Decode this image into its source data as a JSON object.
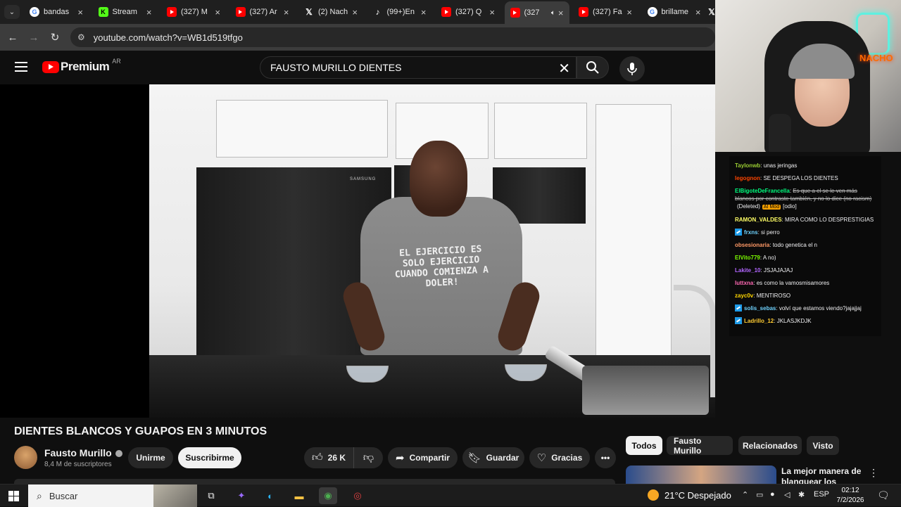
{
  "browser": {
    "tabs": [
      {
        "title": "bandas",
        "favicon": "google-icon",
        "active": false,
        "muted": false
      },
      {
        "title": "Stream",
        "favicon": "kick-icon",
        "active": false,
        "muted": false
      },
      {
        "title": "(327) M",
        "favicon": "youtube-icon",
        "active": false,
        "muted": false
      },
      {
        "title": "(327) Ar",
        "favicon": "youtube-icon",
        "active": false,
        "muted": false
      },
      {
        "title": "(2) Nach",
        "favicon": "x-icon",
        "active": false,
        "muted": false
      },
      {
        "title": "(99+)En",
        "favicon": "tiktok-icon",
        "active": false,
        "muted": false
      },
      {
        "title": "(327) Q",
        "favicon": "youtube-icon",
        "active": false,
        "muted": false
      },
      {
        "title": "(327",
        "favicon": "youtube-icon",
        "active": true,
        "muted": true
      },
      {
        "title": "(327) Fa",
        "favicon": "youtube-icon",
        "active": false,
        "muted": false
      },
      {
        "title": "brillame",
        "favicon": "google-icon",
        "active": false,
        "muted": false
      }
    ],
    "url": "youtube.com/watch?v=WB1d519tfgo"
  },
  "yt": {
    "logo_text": "Premium",
    "region": "AR",
    "search_value": "FAUSTO MURILLO DIENTES"
  },
  "video": {
    "shirt_text": "EL EJERCICIO ES SOLO EJERCICIO CUANDO COMIENZA A DOLER!",
    "fridge_brand": "SAMSUNG",
    "title": "DIENTES BLANCOS Y GUAPOS EN 3 MINUTOS",
    "channel": "Fausto Murillo",
    "subscribers": "8,4 M de suscriptores",
    "join_label": "Unirme",
    "subscribe_label": "Suscribirme",
    "likes": "26 K",
    "share_label": "Compartir",
    "save_label": "Guardar",
    "thanks_label": "Gracias"
  },
  "stream": {
    "neon_text": "NACHO"
  },
  "chat": [
    {
      "user": "Taylonwb",
      "color": "#9acd32",
      "badge": false,
      "deleted": false,
      "message": "unas jeringas"
    },
    {
      "user": "legognon",
      "color": "#ff4500",
      "badge": false,
      "deleted": false,
      "message": "SE DESPEGA LOS DIENTES"
    },
    {
      "user": "ElBigoteDeFrancella",
      "color": "#00ff7f",
      "badge": false,
      "deleted": true,
      "message": "Es que a el se le ven más blancos por contraste también, y no lo dice (no racism)",
      "extra": "(Deleted)",
      "mod": "AI Mod",
      "tag": "[odio]"
    },
    {
      "user": "RAMON_VALDES",
      "color": "#ffff66",
      "badge": false,
      "deleted": false,
      "message": "MIRA COMO LO DESPRESTIGIAS"
    },
    {
      "user": "frxns",
      "color": "#6fd3ff",
      "badge": true,
      "deleted": false,
      "message": "si perro"
    },
    {
      "user": "obsesionaria",
      "color": "#ff9966",
      "badge": false,
      "deleted": false,
      "message": "todo genetica el n"
    },
    {
      "user": "ElVito779",
      "color": "#7cfc00",
      "badge": false,
      "deleted": false,
      "message": "A no)"
    },
    {
      "user": "Lakite_10",
      "color": "#b266ff",
      "badge": false,
      "deleted": false,
      "message": "JSJAJAJAJ"
    },
    {
      "user": "luttxna",
      "color": "#ff69b4",
      "badge": false,
      "deleted": false,
      "message": "es como la vamosmisamores"
    },
    {
      "user": "zayc0v",
      "color": "#ffd700",
      "badge": false,
      "deleted": false,
      "message": "MENTIROSO"
    },
    {
      "user": "solis_sebas",
      "color": "#6fd3ff",
      "badge": true,
      "deleted": false,
      "message": "volví que estamos viendo?jajajjaj"
    },
    {
      "user": "Ladrillo_12",
      "color": "#ffcc33",
      "badge": true,
      "deleted": false,
      "message": "JKLASJKDJK"
    }
  ],
  "chips": [
    "Todos",
    "Fausto Murillo",
    "Relacionados",
    "Visto"
  ],
  "recommendation": {
    "title": "La mejor manera de blanquear los dientes"
  },
  "taskbar": {
    "search_placeholder": "Buscar",
    "weather": "21°C  Despejado",
    "language": "ESP",
    "time": "02:12",
    "date": "7/2/2026"
  }
}
